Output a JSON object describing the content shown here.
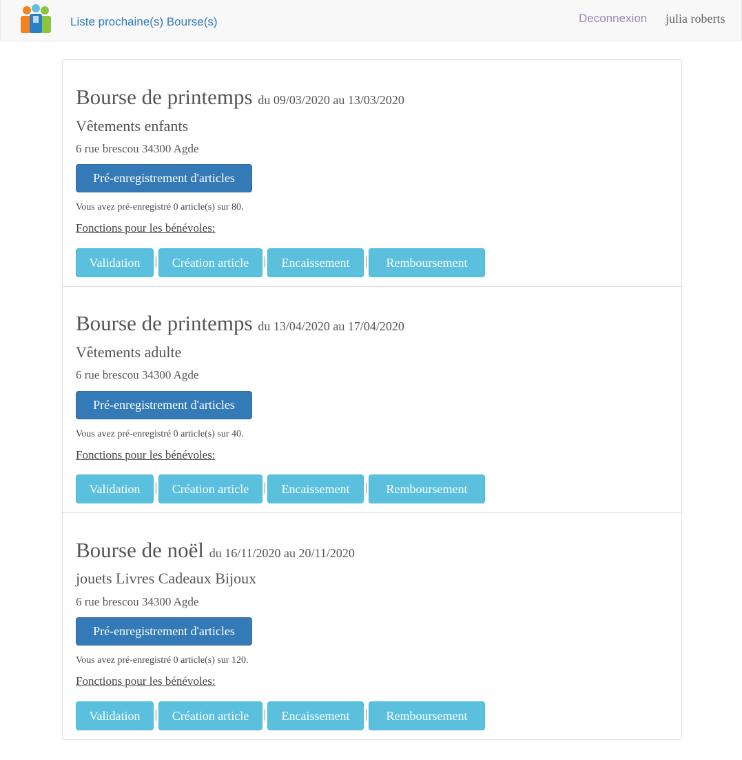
{
  "nav": {
    "brand_icon": "people-group-logo-icon",
    "list_link": "Liste prochaine(s) Bourse(s)",
    "logout_link": "Deconnexion",
    "user_name": "julia roberts"
  },
  "colors": {
    "primary": "#337ab7",
    "info": "#5bc0de",
    "logout": "#9b86b8"
  },
  "events": [
    {
      "title": "Bourse de printemps",
      "dates": "du 09/03/2020 au 13/03/2020",
      "category": "Vêtements enfants",
      "address": "6 rue brescou 34300 Agde",
      "prereg_button": "Pré-enregistrement d'articles",
      "count_text": "Vous avez pré-enregistré 0 article(s) sur 80.",
      "volunteer_heading": "Fonctions pour les bénévoles:",
      "actions": [
        "Validation",
        "Création article",
        "Encaissement",
        "Remboursement"
      ]
    },
    {
      "title": "Bourse de printemps",
      "dates": "du 13/04/2020 au 17/04/2020",
      "category": "Vêtements adulte",
      "address": "6 rue brescou 34300 Agde",
      "prereg_button": "Pré-enregistrement d'articles",
      "count_text": "Vous avez pré-enregistré 0 article(s) sur 40.",
      "volunteer_heading": "Fonctions pour les bénévoles:",
      "actions": [
        "Validation",
        "Création article",
        "Encaissement",
        "Remboursement"
      ]
    },
    {
      "title": "Bourse de noël",
      "dates": "du 16/11/2020 au 20/11/2020",
      "category": "jouets Livres Cadeaux Bijoux",
      "address": "6 rue brescou 34300 Agde",
      "prereg_button": "Pré-enregistrement d'articles",
      "count_text": "Vous avez pré-enregistré 0 article(s) sur 120.",
      "volunteer_heading": "Fonctions pour les bénévoles:",
      "actions": [
        "Validation",
        "Création article",
        "Encaissement",
        "Remboursement"
      ]
    }
  ],
  "separator": "|"
}
